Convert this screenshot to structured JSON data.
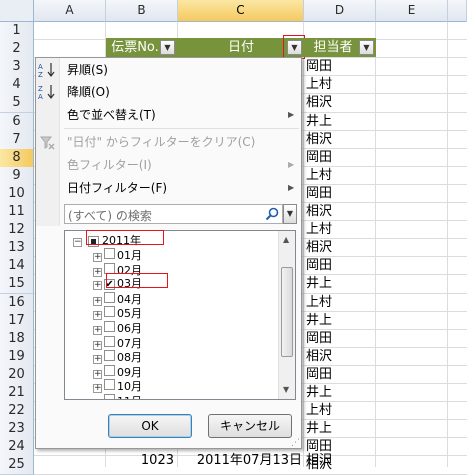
{
  "sheet": {
    "columns": [
      "A",
      "B",
      "C",
      "D",
      "E"
    ],
    "selected_column": "C",
    "rows": [
      "1",
      "2",
      "3",
      "4",
      "5",
      "6",
      "7",
      "8",
      "9",
      "10",
      "11",
      "12",
      "13",
      "14",
      "15",
      "16",
      "17",
      "18",
      "19",
      "20",
      "21",
      "22",
      "23",
      "24",
      "25"
    ],
    "selected_row": "8",
    "header": {
      "col_b": "伝票No.",
      "col_c": "日付",
      "col_d": "担当者"
    },
    "col_d_values": [
      "岡田",
      "上村",
      "相沢",
      "井上",
      "相沢",
      "岡田",
      "上村",
      "岡田",
      "相沢",
      "上村",
      "相沢",
      "岡田",
      "井上",
      "上村",
      "井上",
      "岡田",
      "相沢",
      "岡田",
      "井上",
      "上村",
      "井上",
      "岡田",
      "相沢"
    ],
    "row25": {
      "col_b": "1023",
      "col_c": "2011年07月13日",
      "col_d": "相沢"
    }
  },
  "menu": {
    "sort_asc": "昇順(S)",
    "sort_desc": "降順(O)",
    "sort_by_color": "色で並べ替え(T)",
    "clear_filter": "\"日付\" からフィルターをクリア(C)",
    "color_filter": "色フィルター(I)",
    "date_filter": "日付フィルター(F)",
    "search_placeholder": "(すべて) の検索",
    "tree": {
      "year": "2011年",
      "months": [
        "01月",
        "02月",
        "03月",
        "04月",
        "05月",
        "06月",
        "07月",
        "08月",
        "09月",
        "10月",
        "11月"
      ],
      "checked_month": "03月"
    },
    "ok": "OK",
    "cancel": "キャンセル"
  },
  "colors": {
    "header_fill": "#77933c",
    "highlight_box": "#e8141b",
    "selected_header": "#f5c95f"
  }
}
